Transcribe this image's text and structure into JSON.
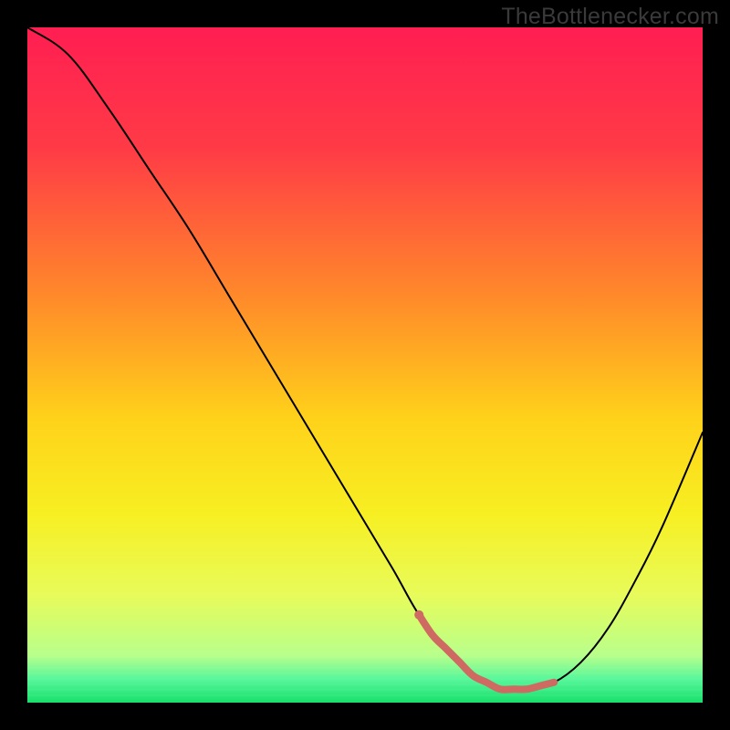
{
  "watermark": "TheBottlenecker.com",
  "chart_data": {
    "type": "line",
    "title": "",
    "xlabel": "",
    "ylabel": "",
    "xlim": [
      0,
      100
    ],
    "ylim": [
      0,
      100
    ],
    "series": [
      {
        "name": "bottleneck-curve",
        "x": [
          0,
          6,
          12,
          18,
          24,
          30,
          36,
          42,
          48,
          54,
          58,
          62,
          66,
          70,
          74,
          78,
          82,
          86,
          90,
          94,
          100
        ],
        "values": [
          100,
          96,
          88,
          79,
          70,
          60,
          50,
          40,
          30,
          20,
          13,
          8,
          4,
          2,
          2,
          3,
          6,
          11,
          18,
          26,
          40
        ],
        "color": "#000000",
        "stroke_width": 2
      },
      {
        "name": "highlight-segment",
        "x": [
          58,
          60,
          62,
          64,
          66,
          68,
          70,
          72,
          74,
          76,
          78
        ],
        "values": [
          13,
          10,
          8,
          6,
          4,
          3,
          2,
          2,
          2,
          2.5,
          3
        ],
        "color": "#cf6a63",
        "stroke_width": 8
      }
    ],
    "highlight_marker": {
      "x": 58,
      "y": 13,
      "r": 5,
      "color": "#cf6a63"
    },
    "background_gradient": {
      "stops": [
        {
          "offset": 0.0,
          "color": "#ff1e52"
        },
        {
          "offset": 0.18,
          "color": "#ff3b46"
        },
        {
          "offset": 0.4,
          "color": "#ff8a2a"
        },
        {
          "offset": 0.58,
          "color": "#ffd21a"
        },
        {
          "offset": 0.72,
          "color": "#f7ef22"
        },
        {
          "offset": 0.84,
          "color": "#e8fb5a"
        },
        {
          "offset": 0.93,
          "color": "#b8ff8a"
        },
        {
          "offset": 0.965,
          "color": "#57f79a"
        },
        {
          "offset": 1.0,
          "color": "#18e06c"
        }
      ]
    }
  }
}
